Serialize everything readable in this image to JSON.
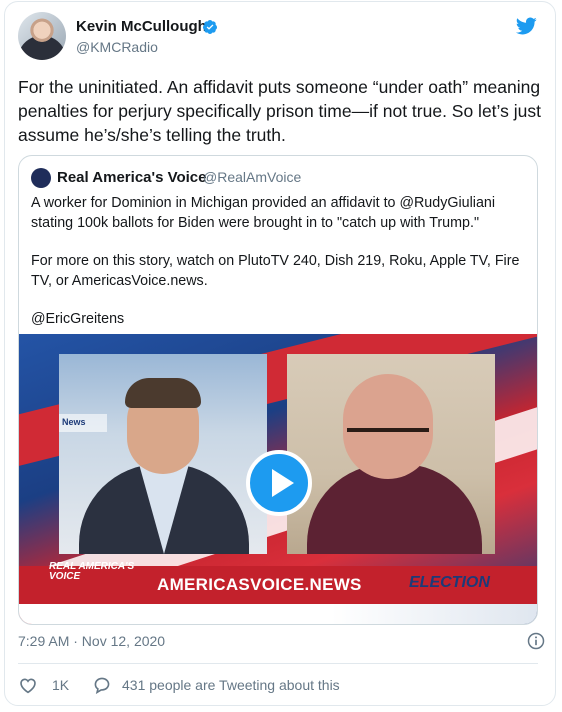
{
  "tweet": {
    "author_name": "Kevin McCullough",
    "author_handle": "@KMCRadio",
    "text": "For the uninitiated. An affidavit puts someone “under oath” meaning penalties  for perjury specifically prison time—if not true. So let’s just assume he’s/she’s telling the truth.",
    "timestamp": "7:29 AM · Nov 12, 2020",
    "like_count": "1K",
    "conversation_text": "431 people are Tweeting about this"
  },
  "quote": {
    "author_name": "Real America's Voice",
    "author_handle": "@RealAmVoice",
    "paragraphs": [
      "A worker for Dominion in Michigan provided an affidavit to @RudyGiuliani stating 100k ballots for Biden were brought in to \"catch up with Trump.\"",
      "For more on this story, watch on PlutoTV 240, Dish 219, Roku, Apple TV, Fire TV, or AmericasVoice.news.",
      "@EricGreitens"
    ],
    "video": {
      "brand_logo": "REAL AMERICA'S VOICE",
      "site_url": "AMERICASVOICE.NEWS",
      "election_tag": "ELECTION",
      "news_sign": "News"
    }
  },
  "icons": {
    "verified": "verified-badge-icon",
    "twitter_logo": "twitter-bird-icon",
    "info": "info-icon",
    "like": "heart-icon",
    "reply": "speech-bubble-icon",
    "play": "play-icon"
  },
  "colors": {
    "accent": "#1d9bf0",
    "secondary_text": "#657786",
    "border": "#e1e8ed"
  }
}
